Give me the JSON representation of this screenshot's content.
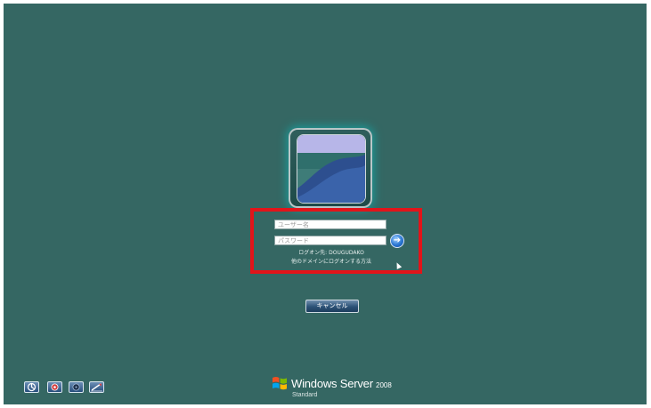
{
  "login": {
    "username_placeholder": "ユーザー名",
    "password_placeholder": "パスワード",
    "submit_icon": "arrow-right-icon",
    "logon_target": "ログオン先: DOUGUDAKO",
    "other_domain_hint": "他のドメインにログオンする方法",
    "cancel_label": "キャンセル"
  },
  "ease_of_access": {
    "icons": [
      "accessibility-icon",
      "security-icon",
      "disk-icon",
      "pen-icon"
    ]
  },
  "brand": {
    "name": "Windows Server",
    "version": "2008",
    "edition": "Standard"
  },
  "colors": {
    "background": "#356763",
    "highlight_box": "#e2141a",
    "submit_button": "#2a76d2",
    "cancel_button": "#2b5176"
  }
}
